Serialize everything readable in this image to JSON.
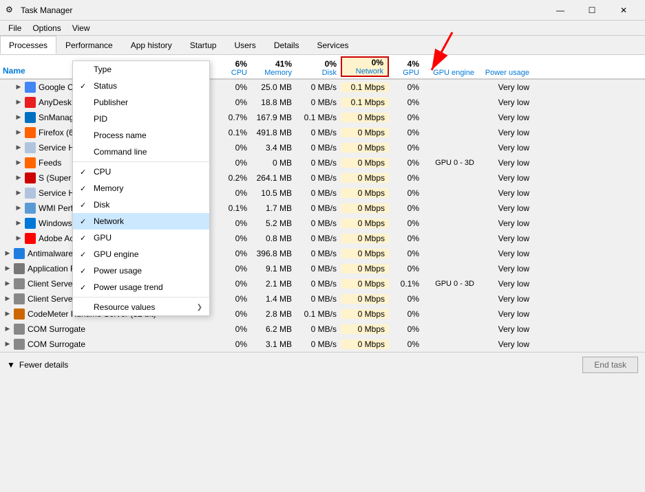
{
  "titleBar": {
    "icon": "⚙",
    "title": "Task Manager",
    "minimize": "—",
    "maximize": "☐",
    "close": "✕"
  },
  "menuBar": {
    "items": [
      "File",
      "Options",
      "View"
    ]
  },
  "tabs": [
    {
      "label": "Processes"
    },
    {
      "label": "Performance"
    },
    {
      "label": "App history"
    },
    {
      "label": "Startup"
    },
    {
      "label": "Users"
    },
    {
      "label": "Details"
    },
    {
      "label": "Services"
    }
  ],
  "activeTab": "Processes",
  "columns": {
    "name": "Name",
    "cpu": {
      "percent": "6%",
      "label": "CPU"
    },
    "memory": {
      "percent": "41%",
      "label": "Memory"
    },
    "disk": {
      "percent": "0%",
      "label": "Disk"
    },
    "network": {
      "percent": "0%",
      "label": "Network"
    },
    "gpu": {
      "percent": "4%",
      "label": "GPU"
    },
    "gpuEngine": {
      "label": "GPU engine"
    },
    "powerUsage": {
      "label": "Power usage"
    }
  },
  "contextMenu": {
    "items": [
      {
        "label": "Type",
        "checked": false
      },
      {
        "label": "Status",
        "checked": true
      },
      {
        "label": "Publisher",
        "checked": false
      },
      {
        "label": "PID",
        "checked": false
      },
      {
        "label": "Process name",
        "checked": false
      },
      {
        "label": "Command line",
        "checked": false
      },
      {
        "label": "CPU",
        "checked": true
      },
      {
        "label": "Memory",
        "checked": true
      },
      {
        "label": "Disk",
        "checked": true
      },
      {
        "label": "Network",
        "checked": true,
        "selected": true
      },
      {
        "label": "GPU",
        "checked": true
      },
      {
        "label": "GPU engine",
        "checked": true
      },
      {
        "label": "Power usage",
        "checked": true
      },
      {
        "label": "Power usage trend",
        "checked": true
      },
      {
        "label": "Resource values",
        "checked": false,
        "hasSubmenu": true
      }
    ]
  },
  "processes": [
    {
      "name": "Google C…",
      "icon": "google",
      "expanded": false,
      "cpu": "0%",
      "memory": "25.0 MB",
      "disk": "0 MB/s",
      "network": "0.1 Mbps",
      "gpu": "0%",
      "gpuEngine": "",
      "power": "Very low",
      "indent": 1
    },
    {
      "name": "AnyDesk",
      "icon": "anydesk",
      "expanded": false,
      "cpu": "0%",
      "memory": "18.8 MB",
      "disk": "0 MB/s",
      "network": "0.1 Mbps",
      "gpu": "0%",
      "gpuEngine": "",
      "power": "Very low",
      "indent": 1
    },
    {
      "name": "SnManag…",
      "icon": "snmanager",
      "expanded": false,
      "cpu": "0.7%",
      "memory": "167.9 MB",
      "disk": "0.1 MB/s",
      "network": "0 Mbps",
      "gpu": "0%",
      "gpuEngine": "",
      "power": "Very low",
      "indent": 1
    },
    {
      "name": "Firefox (6…",
      "icon": "firefox",
      "expanded": false,
      "cpu": "0.1%",
      "memory": "491.8 MB",
      "disk": "0 MB/s",
      "network": "0 Mbps",
      "gpu": "0%",
      "gpuEngine": "",
      "power": "Very low",
      "indent": 1
    },
    {
      "name": "Service H…",
      "icon": "service",
      "expanded": false,
      "cpu": "0%",
      "memory": "3.4 MB",
      "disk": "0 MB/s",
      "network": "0 Mbps",
      "gpu": "0%",
      "gpuEngine": "",
      "power": "Very low",
      "indent": 1
    },
    {
      "name": "Feeds",
      "icon": "feeds",
      "expanded": false,
      "cpu": "0%",
      "memory": "0 MB",
      "disk": "0 MB/s",
      "network": "0 Mbps",
      "gpu": "0%",
      "gpuEngine": "GPU 0 - 3D",
      "power": "Very low",
      "indent": 1
    },
    {
      "name": "S (Super…)",
      "icon": "superantispyware",
      "expanded": false,
      "cpu": "0.2%",
      "memory": "264.1 MB",
      "disk": "0 MB/s",
      "network": "0 Mbps",
      "gpu": "0%",
      "gpuEngine": "",
      "power": "Very low",
      "indent": 1
    },
    {
      "name": "Service H…",
      "icon": "service",
      "expanded": false,
      "cpu": "0%",
      "memory": "10.5 MB",
      "disk": "0 MB/s",
      "network": "0 Mbps",
      "gpu": "0%",
      "gpuEngine": "",
      "power": "Very low",
      "indent": 1
    },
    {
      "name": "WMI Perf…",
      "icon": "wmi",
      "expanded": false,
      "cpu": "0.1%",
      "memory": "1.7 MB",
      "disk": "0 MB/s",
      "network": "0 Mbps",
      "gpu": "0%",
      "gpuEngine": "",
      "power": "Very low",
      "indent": 1
    },
    {
      "name": "Windows…",
      "icon": "windows",
      "expanded": false,
      "cpu": "0%",
      "memory": "5.2 MB",
      "disk": "0 MB/s",
      "network": "0 Mbps",
      "gpu": "0%",
      "gpuEngine": "",
      "power": "Very low",
      "indent": 1
    },
    {
      "name": "Adobe Ac…",
      "icon": "adobe",
      "expanded": false,
      "cpu": "0%",
      "memory": "0.8 MB",
      "disk": "0 MB/s",
      "network": "0 Mbps",
      "gpu": "0%",
      "gpuEngine": "",
      "power": "Very low",
      "indent": 1
    },
    {
      "name": "Antimalware Service Executable",
      "icon": "antimalware",
      "expanded": false,
      "cpu": "0%",
      "memory": "396.8 MB",
      "disk": "0 MB/s",
      "network": "0 Mbps",
      "gpu": "0%",
      "gpuEngine": "",
      "power": "Very low",
      "indent": 0
    },
    {
      "name": "Application Frame Host",
      "icon": "appframe",
      "expanded": false,
      "cpu": "0%",
      "memory": "9.1 MB",
      "disk": "0 MB/s",
      "network": "0 Mbps",
      "gpu": "0%",
      "gpuEngine": "",
      "power": "Very low",
      "indent": 0
    },
    {
      "name": "Client Server Runtime Process",
      "icon": "csrss",
      "expanded": false,
      "cpu": "0%",
      "memory": "2.1 MB",
      "disk": "0 MB/s",
      "network": "0 Mbps",
      "gpu": "0.1%",
      "gpuEngine": "GPU 0 - 3D",
      "power": "Very low",
      "indent": 0
    },
    {
      "name": "Client Server Runtime Process",
      "icon": "csrss",
      "expanded": false,
      "cpu": "0%",
      "memory": "1.4 MB",
      "disk": "0 MB/s",
      "network": "0 Mbps",
      "gpu": "0%",
      "gpuEngine": "",
      "power": "Very low",
      "indent": 0
    },
    {
      "name": "CodeMeter Runtime Server (32 bit)",
      "icon": "codemeter",
      "expanded": false,
      "cpu": "0%",
      "memory": "2.8 MB",
      "disk": "0.1 MB/s",
      "network": "0 Mbps",
      "gpu": "0%",
      "gpuEngine": "",
      "power": "Very low",
      "indent": 0
    },
    {
      "name": "COM Surrogate",
      "icon": "comsurrogate",
      "expanded": false,
      "cpu": "0%",
      "memory": "6.2 MB",
      "disk": "0 MB/s",
      "network": "0 Mbps",
      "gpu": "0%",
      "gpuEngine": "",
      "power": "Very low",
      "indent": 0
    },
    {
      "name": "COM Surrogate",
      "icon": "comsurrogate",
      "expanded": false,
      "cpu": "0%",
      "memory": "3.1 MB",
      "disk": "0 MB/s",
      "network": "0 Mbps",
      "gpu": "0%",
      "gpuEngine": "",
      "power": "Very low",
      "indent": 0
    }
  ],
  "statusBar": {
    "fewerDetails": "Fewer details",
    "endTask": "End task"
  }
}
